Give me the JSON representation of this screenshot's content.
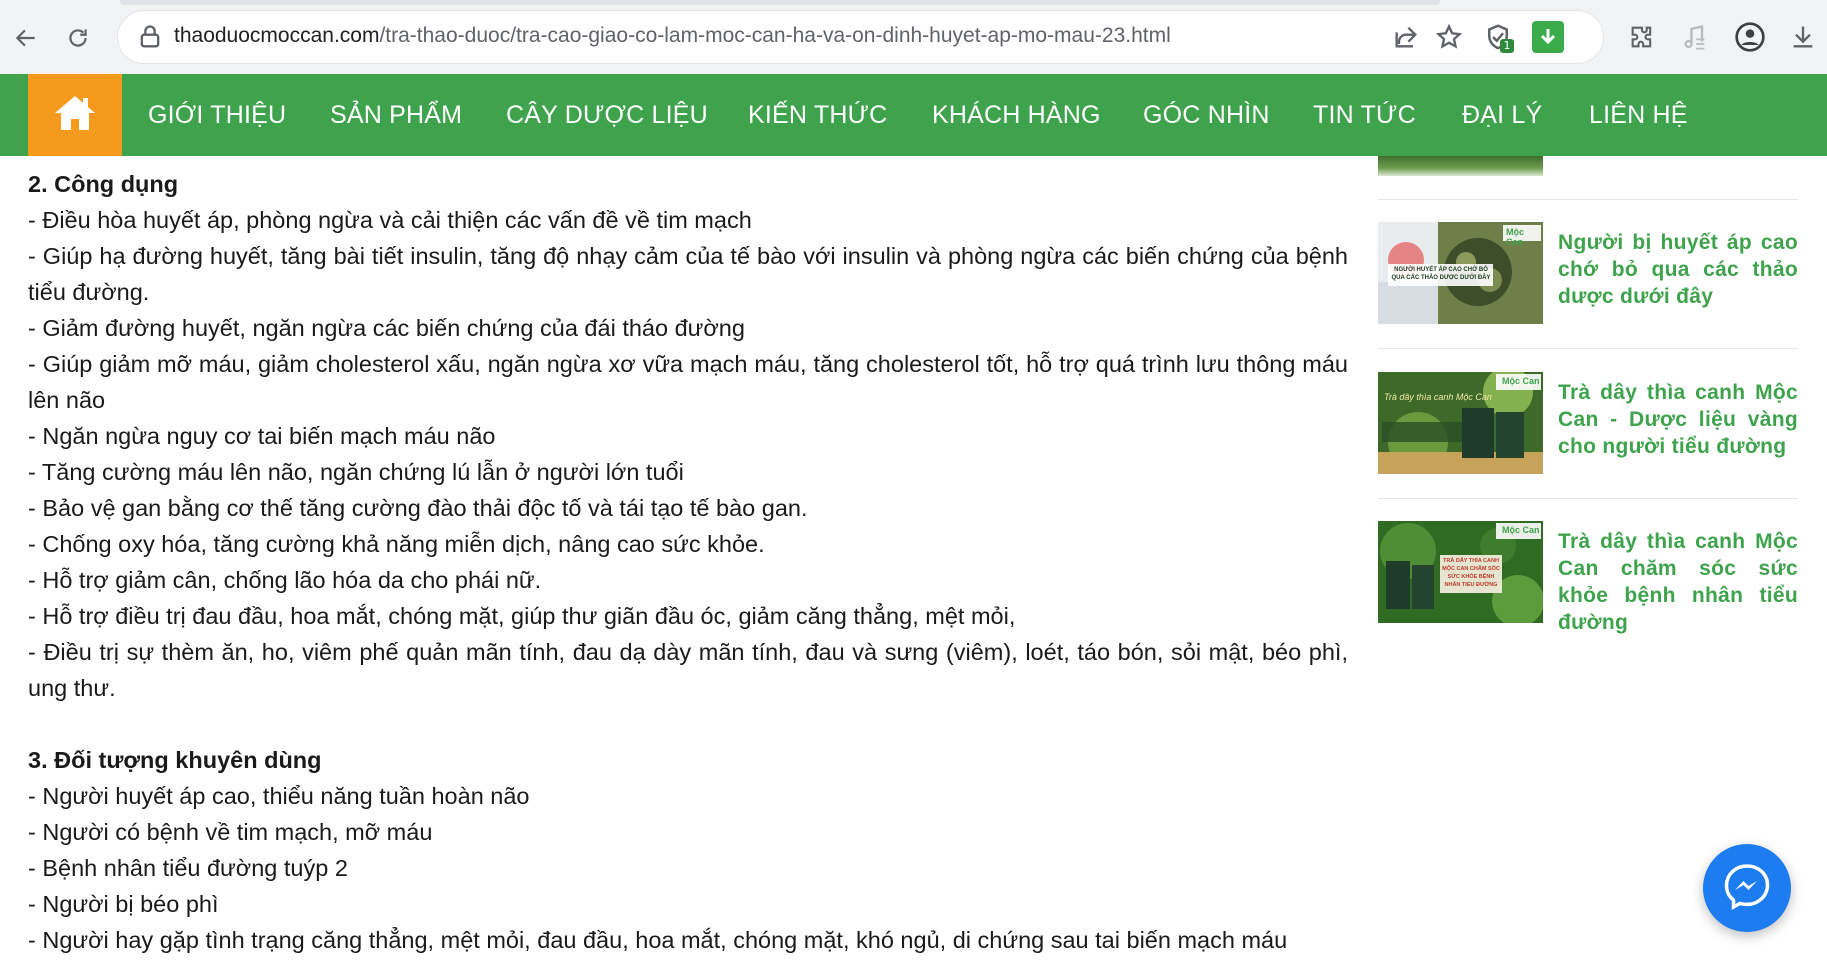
{
  "browser": {
    "url_host": "thaoduocmoccan.com",
    "url_path": "/tra-thao-duoc/tra-cao-giao-co-lam-moc-can-ha-va-on-dinh-huyet-ap-mo-mau-23.html",
    "extension_badge": "1"
  },
  "nav": {
    "items": [
      "GIỚI THIỆU",
      "SẢN PHẨM",
      "CÂY DƯỢC LIỆU",
      "KIẾN THỨC",
      "KHÁCH HÀNG",
      "GÓC NHÌN",
      "TIN TỨC",
      "ĐẠI LÝ",
      "LIÊN HỆ"
    ]
  },
  "article": {
    "section2_title": "2. Công dụng",
    "section2_lines": [
      "- Điều hòa huyết áp, phòng ngừa và cải thiện các vấn đề về tim mạch",
      "- Giúp hạ đường huyết, tăng bài tiết insulin, tăng độ nhạy cảm của tế bào với insulin và phòng ngừa các biến chứng của bệnh tiểu đường.",
      "- Giảm đường huyết, ngăn ngừa các biến chứng của đái tháo đường",
      "- Giúp giảm mỡ máu, giảm cholesterol xấu, ngăn ngừa xơ vữa mạch máu, tăng cholesterol tốt, hỗ trợ quá trình lưu thông máu lên não",
      "- Ngăn ngừa nguy cơ tai biến mạch máu não",
      "- Tăng cường máu lên não, ngăn chứng lú lẫn ở người lớn tuổi",
      "- Bảo vệ gan bằng cơ thế tăng cường đào thải độc tố và tái tạo tế bào gan.",
      "- Chống oxy hóa, tăng cường khả năng miễn dịch, nâng cao sức khỏe.",
      "- Hỗ trợ giảm cân, chống lão hóa da cho phái nữ.",
      "- Hỗ trợ điều trị đau đầu, hoa mắt, chóng mặt, giúp thư giãn đầu óc, giảm căng thẳng, mệt mỏi,",
      "- Điều trị sự thèm ăn, ho, viêm phế quản mãn tính, đau dạ dày mãn tính, đau và sưng (viêm), loét, táo bón, sỏi mật, béo phì, ung thư."
    ],
    "section3_title": "3. Đối tượng khuyên dùng",
    "section3_lines": [
      "- Người huyết áp cao, thiểu năng tuần hoàn não",
      "- Người có bệnh về tim mạch, mỡ máu",
      "- Bệnh nhân tiểu đường tuýp 2",
      "- Người bị béo phì",
      "- Người hay gặp tình trạng căng thẳng, mệt mỏi, đau đầu, hoa mắt, chóng mặt, khó ngủ, di chứng sau tai biến mạch máu"
    ]
  },
  "sidebar": {
    "posts": [
      {
        "title": "Người bị huyết áp cao chớ bỏ qua các thảo dược dưới đây",
        "thumb_caption": "NGƯỜI HUYẾT ÁP CAO CHỚ BỎ QUA CÁC THẢO DƯỢC DƯỚI ĐÂY",
        "thumb_logo": "Mộc Can"
      },
      {
        "title": "Trà dây thìa canh Mộc Can - Dược liệu vàng cho người tiểu đường",
        "thumb_caption": "Trà dây thìa canh Mộc Can",
        "thumb_logo": "Mộc Can"
      },
      {
        "title": "Trà dây thìa canh Mộc Can chăm sóc sức khỏe bệnh nhân tiểu đường",
        "thumb_caption": "TRÀ DÂY THÌA CANH MỘC CAN CHĂM SÓC SỨC KHỎE BỆNH NHÂN TIỂU ĐƯỜNG",
        "thumb_logo": "Mộc Can"
      }
    ]
  },
  "colors": {
    "nav_green": "#3fa34d",
    "home_orange": "#f59a1d",
    "link_green": "#3fa34d",
    "messenger_blue": "#1c7cf0"
  },
  "icons": [
    "back-arrow-icon",
    "reload-icon",
    "lock-icon",
    "share-icon",
    "star-icon",
    "shield-extension-icon",
    "download-badge-icon",
    "puzzle-icon",
    "music-note-icon",
    "profile-icon",
    "download-icon",
    "home-icon",
    "messenger-icon"
  ]
}
